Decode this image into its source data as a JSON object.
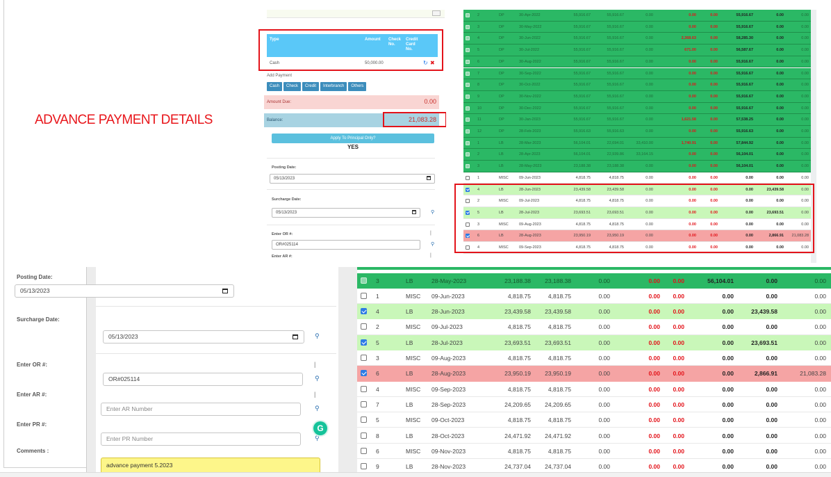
{
  "headline": "ADVANCE PAYMENT DETAILS",
  "colors": {
    "green": "#2bb865",
    "light_green": "#c9f7b9",
    "pink": "#f5a4a4",
    "blue_header": "#5ac8f8",
    "annotation_red": "#e3131a"
  },
  "small_form": {
    "payment_table": {
      "headers": {
        "type": "Type",
        "amount": "Amount",
        "check_no": "Check No.",
        "credit_card_no": "Credit Card No."
      },
      "row": {
        "type": "Cash",
        "amount": "50,000.00"
      }
    },
    "add_payment": "Add Payment",
    "buttons": [
      "Cash",
      "Check",
      "Credit",
      "Interbranch",
      "Others"
    ],
    "amount_due_label": "Amount Due:",
    "amount_due_value": "0.00",
    "balance_label": "Balance:",
    "balance_value": "21,083.28",
    "apply_principal": "Apply To Principal Only?",
    "apply_value": "YES",
    "posting_date_label": "Posting Date:",
    "posting_date": "05/13/2023",
    "surcharge_date_label": "Surcharge Date:",
    "surcharge_date": "05/13/2023",
    "or_label": "Enter OR #:",
    "or_value": "OR#025114",
    "ar_label": "Enter AR #:"
  },
  "small_table_rows": [
    {
      "n": "2",
      "type": "DP",
      "date": "30-Apr-2022",
      "a1": "55,916.67",
      "a2": "55,916.67",
      "a3": "0.00",
      "a4": "",
      "r1": "0.00",
      "r2": "0.00",
      "b1": "55,916.67",
      "b2": "0.00",
      "b3": "0.00",
      "style": "paid"
    },
    {
      "n": "3",
      "type": "DP",
      "date": "30-May-2022",
      "a1": "55,916.67",
      "a2": "55,916.67",
      "a3": "0.00",
      "a4": "",
      "r1": "0.00",
      "r2": "0.00",
      "b1": "55,916.67",
      "b2": "0.00",
      "b3": "0.00",
      "style": "paid"
    },
    {
      "n": "4",
      "type": "DP",
      "date": "30-Jun-2022",
      "a1": "55,916.67",
      "a2": "55,916.67",
      "a3": "0.00",
      "a4": "",
      "r1": "2,368.63",
      "r2": "0.00",
      "b1": "58,285.30",
      "b2": "0.00",
      "b3": "0.00",
      "style": "paid"
    },
    {
      "n": "5",
      "type": "DP",
      "date": "30-Jul-2022",
      "a1": "55,916.67",
      "a2": "55,916.67",
      "a3": "0.00",
      "a4": "",
      "r1": "671.00",
      "r2": "0.00",
      "b1": "56,587.67",
      "b2": "0.00",
      "b3": "0.00",
      "style": "paid"
    },
    {
      "n": "6",
      "type": "DP",
      "date": "30-Aug-2022",
      "a1": "55,916.67",
      "a2": "55,916.67",
      "a3": "0.00",
      "a4": "",
      "r1": "0.00",
      "r2": "0.00",
      "b1": "55,916.67",
      "b2": "0.00",
      "b3": "0.00",
      "style": "paid"
    },
    {
      "n": "7",
      "type": "DP",
      "date": "30-Sep-2022",
      "a1": "55,916.67",
      "a2": "55,916.67",
      "a3": "0.00",
      "a4": "",
      "r1": "0.00",
      "r2": "0.00",
      "b1": "55,916.67",
      "b2": "0.00",
      "b3": "0.00",
      "style": "paid"
    },
    {
      "n": "8",
      "type": "DP",
      "date": "30-Oct-2022",
      "a1": "55,916.67",
      "a2": "55,916.67",
      "a3": "0.00",
      "a4": "",
      "r1": "0.00",
      "r2": "0.00",
      "b1": "55,916.67",
      "b2": "0.00",
      "b3": "0.00",
      "style": "paid"
    },
    {
      "n": "9",
      "type": "DP",
      "date": "30-Nov-2022",
      "a1": "55,916.67",
      "a2": "55,916.67",
      "a3": "0.00",
      "a4": "",
      "r1": "0.00",
      "r2": "0.00",
      "b1": "55,916.67",
      "b2": "0.00",
      "b3": "0.00",
      "style": "paid"
    },
    {
      "n": "10",
      "type": "DP",
      "date": "30-Dec-2022",
      "a1": "55,916.67",
      "a2": "55,916.67",
      "a3": "0.00",
      "a4": "",
      "r1": "0.00",
      "r2": "0.00",
      "b1": "55,916.67",
      "b2": "0.00",
      "b3": "0.00",
      "style": "paid"
    },
    {
      "n": "11",
      "type": "DP",
      "date": "30-Jan-2023",
      "a1": "55,916.67",
      "a2": "55,916.67",
      "a3": "0.00",
      "a4": "",
      "r1": "1,621.58",
      "r2": "0.00",
      "b1": "57,538.25",
      "b2": "0.00",
      "b3": "0.00",
      "style": "paid"
    },
    {
      "n": "12",
      "type": "DP",
      "date": "28-Feb-2023",
      "a1": "55,916.63",
      "a2": "55,916.63",
      "a3": "0.00",
      "a4": "",
      "r1": "0.00",
      "r2": "0.00",
      "b1": "55,916.63",
      "b2": "0.00",
      "b3": "0.00",
      "style": "paid"
    },
    {
      "n": "1",
      "type": "LB",
      "date": "28-Mar-2023",
      "a1": "56,104.01",
      "a2": "22,694.01",
      "a3": "33,410.00",
      "a4": "",
      "r1": "1,740.91",
      "r2": "0.00",
      "b1": "57,844.92",
      "b2": "0.00",
      "b3": "0.00",
      "style": "paid"
    },
    {
      "n": "2",
      "type": "LB",
      "date": "28-Apr-2023",
      "a1": "56,104.01",
      "a2": "22,939.86",
      "a3": "33,164.15",
      "a4": "",
      "r1": "0.00",
      "r2": "0.00",
      "b1": "56,104.01",
      "b2": "0.00",
      "b3": "0.00",
      "style": "paid"
    },
    {
      "n": "3",
      "type": "LB",
      "date": "28-May-2023",
      "a1": "23,188.38",
      "a2": "23,188.38",
      "a3": "0.00",
      "a4": "",
      "r1": "0.00",
      "r2": "0.00",
      "b1": "56,104.01",
      "b2": "0.00",
      "b3": "0.00",
      "style": "paid"
    },
    {
      "n": "1",
      "type": "MISC",
      "date": "09-Jun-2023",
      "a1": "4,818.75",
      "a2": "4,818.75",
      "a3": "0.00",
      "a4": "",
      "r1": "0.00",
      "r2": "0.00",
      "b1": "0.00",
      "b2": "0.00",
      "b3": "0.00",
      "style": "white"
    },
    {
      "n": "4",
      "type": "LB",
      "date": "28-Jun-2023",
      "a1": "23,439.58",
      "a2": "23,439.58",
      "a3": "0.00",
      "a4": "",
      "r1": "0.00",
      "r2": "0.00",
      "b1": "0.00",
      "b2": "23,439.58",
      "b3": "0.00",
      "style": "selected"
    },
    {
      "n": "2",
      "type": "MISC",
      "date": "09-Jul-2023",
      "a1": "4,818.75",
      "a2": "4,818.75",
      "a3": "0.00",
      "a4": "",
      "r1": "0.00",
      "r2": "0.00",
      "b1": "0.00",
      "b2": "0.00",
      "b3": "0.00",
      "style": "white"
    },
    {
      "n": "5",
      "type": "LB",
      "date": "28-Jul-2023",
      "a1": "23,693.51",
      "a2": "23,693.51",
      "a3": "0.00",
      "a4": "",
      "r1": "0.00",
      "r2": "0.00",
      "b1": "0.00",
      "b2": "23,693.51",
      "b3": "0.00",
      "style": "selected"
    },
    {
      "n": "3",
      "type": "MISC",
      "date": "09-Aug-2023",
      "a1": "4,818.75",
      "a2": "4,818.75",
      "a3": "0.00",
      "a4": "",
      "r1": "0.00",
      "r2": "0.00",
      "b1": "0.00",
      "b2": "0.00",
      "b3": "0.00",
      "style": "white"
    },
    {
      "n": "6",
      "type": "LB",
      "date": "28-Aug-2023",
      "a1": "23,950.19",
      "a2": "23,950.19",
      "a3": "0.00",
      "a4": "",
      "r1": "0.00",
      "r2": "0.00",
      "b1": "0.00",
      "b2": "2,866.91",
      "b3": "21,083.28",
      "style": "partial"
    },
    {
      "n": "4",
      "type": "MISC",
      "date": "09-Sep-2023",
      "a1": "4,818.75",
      "a2": "4,818.75",
      "a3": "0.00",
      "a4": "",
      "r1": "0.00",
      "r2": "0.00",
      "b1": "0.00",
      "b2": "0.00",
      "b3": "0.00",
      "style": "white"
    }
  ],
  "large_form": {
    "posting_date_label": "Posting Date:",
    "posting_date": "05/13/2023",
    "surcharge_date_label": "Surcharge Date:",
    "surcharge_date": "05/13/2023",
    "or_label": "Enter OR #:",
    "or_value": "OR#025114",
    "ar_label": "Enter AR #:",
    "ar_placeholder": "Enter AR Number",
    "pr_label": "Enter PR #:",
    "pr_placeholder": "Enter PR Number",
    "comments_label": "Comments :",
    "comments_value": "advance payment 5.2023"
  },
  "large_table_rows": [
    {
      "n": "3",
      "type": "LB",
      "date": "28-May-2023",
      "a1": "23,188.38",
      "a2": "23,188.38",
      "a3": "0.00",
      "r1": "0.00",
      "r2": "0.00",
      "b1": "56,104.01",
      "b2": "0.00",
      "b3": "0.00",
      "style": "paid"
    },
    {
      "n": "1",
      "type": "MISC",
      "date": "09-Jun-2023",
      "a1": "4,818.75",
      "a2": "4,818.75",
      "a3": "0.00",
      "r1": "0.00",
      "r2": "0.00",
      "b1": "0.00",
      "b2": "0.00",
      "b3": "0.00",
      "style": "white"
    },
    {
      "n": "4",
      "type": "LB",
      "date": "28-Jun-2023",
      "a1": "23,439.58",
      "a2": "23,439.58",
      "a3": "0.00",
      "r1": "0.00",
      "r2": "0.00",
      "b1": "0.00",
      "b2": "23,439.58",
      "b3": "0.00",
      "style": "selected"
    },
    {
      "n": "2",
      "type": "MISC",
      "date": "09-Jul-2023",
      "a1": "4,818.75",
      "a2": "4,818.75",
      "a3": "0.00",
      "r1": "0.00",
      "r2": "0.00",
      "b1": "0.00",
      "b2": "0.00",
      "b3": "0.00",
      "style": "white"
    },
    {
      "n": "5",
      "type": "LB",
      "date": "28-Jul-2023",
      "a1": "23,693.51",
      "a2": "23,693.51",
      "a3": "0.00",
      "r1": "0.00",
      "r2": "0.00",
      "b1": "0.00",
      "b2": "23,693.51",
      "b3": "0.00",
      "style": "selected"
    },
    {
      "n": "3",
      "type": "MISC",
      "date": "09-Aug-2023",
      "a1": "4,818.75",
      "a2": "4,818.75",
      "a3": "0.00",
      "r1": "0.00",
      "r2": "0.00",
      "b1": "0.00",
      "b2": "0.00",
      "b3": "0.00",
      "style": "white"
    },
    {
      "n": "6",
      "type": "LB",
      "date": "28-Aug-2023",
      "a1": "23,950.19",
      "a2": "23,950.19",
      "a3": "0.00",
      "r1": "0.00",
      "r2": "0.00",
      "b1": "0.00",
      "b2": "2,866.91",
      "b3": "21,083.28",
      "style": "partial"
    },
    {
      "n": "4",
      "type": "MISC",
      "date": "09-Sep-2023",
      "a1": "4,818.75",
      "a2": "4,818.75",
      "a3": "0.00",
      "r1": "0.00",
      "r2": "0.00",
      "b1": "0.00",
      "b2": "0.00",
      "b3": "0.00",
      "style": "white"
    },
    {
      "n": "7",
      "type": "LB",
      "date": "28-Sep-2023",
      "a1": "24,209.65",
      "a2": "24,209.65",
      "a3": "0.00",
      "r1": "0.00",
      "r2": "0.00",
      "b1": "0.00",
      "b2": "0.00",
      "b3": "0.00",
      "style": "white"
    },
    {
      "n": "5",
      "type": "MISC",
      "date": "09-Oct-2023",
      "a1": "4,818.75",
      "a2": "4,818.75",
      "a3": "0.00",
      "r1": "0.00",
      "r2": "0.00",
      "b1": "0.00",
      "b2": "0.00",
      "b3": "0.00",
      "style": "white"
    },
    {
      "n": "8",
      "type": "LB",
      "date": "28-Oct-2023",
      "a1": "24,471.92",
      "a2": "24,471.92",
      "a3": "0.00",
      "r1": "0.00",
      "r2": "0.00",
      "b1": "0.00",
      "b2": "0.00",
      "b3": "0.00",
      "style": "white"
    },
    {
      "n": "6",
      "type": "MISC",
      "date": "09-Nov-2023",
      "a1": "4,818.75",
      "a2": "4,818.75",
      "a3": "0.00",
      "r1": "0.00",
      "r2": "0.00",
      "b1": "0.00",
      "b2": "0.00",
      "b3": "0.00",
      "style": "white"
    },
    {
      "n": "9",
      "type": "LB",
      "date": "28-Nov-2023",
      "a1": "24,737.04",
      "a2": "24,737.04",
      "a3": "0.00",
      "r1": "0.00",
      "r2": "0.00",
      "b1": "0.00",
      "b2": "0.00",
      "b3": "0.00",
      "style": "white"
    }
  ]
}
